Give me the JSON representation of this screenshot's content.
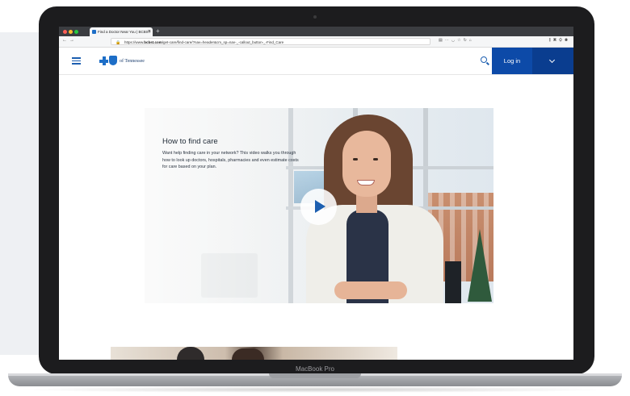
{
  "device": {
    "label": "MacBook Pro"
  },
  "browser": {
    "tab_title": "Find a Doctor Near You | BCBST",
    "url_prefix": "https://www.",
    "url_host": "bcbst.com",
    "url_path": "/get-care/find-care/?nav=header&cm_sp=nav-_-callout_button-_-Find_Care",
    "nav_icons": [
      "back-icon",
      "forward-icon"
    ],
    "toolbar_icons": [
      "reader-icon",
      "more-icon",
      "pocket-icon",
      "star-icon",
      "refresh-icon",
      "home-icon"
    ]
  },
  "header": {
    "logo_text": "of Tennessee",
    "login_label": "Log in",
    "accent_color": "#0d4aa8",
    "accent_dark": "#0a3d8f"
  },
  "video": {
    "title": "How to find care",
    "description": "Want help finding care in your network? This video walks you through how to look up doctors, hospitals, pharmacies and even estimate costs for care based on your plan."
  }
}
